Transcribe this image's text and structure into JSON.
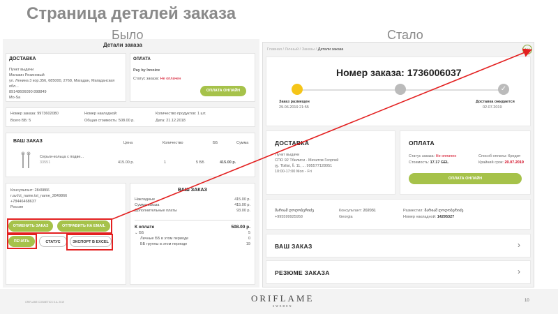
{
  "slide": {
    "title": "Страница деталей заказа",
    "before_label": "Было",
    "after_label": "Стало",
    "page_number": "10",
    "footnote": "ORIFLAME COSMETICS S.A. 2019",
    "logo": "ORIFLAME",
    "logo_sub": "SWEDEN"
  },
  "before": {
    "header": "Детали заказа",
    "delivery": {
      "title": "ДОСТАВКА",
      "lines": [
        "Пункт выдачи",
        "Магазин Резиновый",
        "ул. Ленина 3 кор.356, 685000, 2768, Магадан, Магаданская обл...",
        "89148606090 898849",
        "Mo-Sa"
      ]
    },
    "payment": {
      "title": "ОПЛАТА",
      "method": "Pay by Invoice",
      "status_label": "Статус заказа:",
      "status_value": "Не оплачен",
      "pay_button": "ОПЛАТА ОНЛАЙН"
    },
    "info": {
      "order_no": "Номер заказа: 9973602080",
      "bb_total": "Всего ББ: 5",
      "waybill": "Номер накладной:",
      "total_cost": "Общая стоимость: 508.00 р.",
      "product_count": "Количество продуктов: 1 шт.",
      "date": "Дата: 21.12.2018"
    },
    "order": {
      "title": "ВАШ ЗАКАЗ",
      "columns": [
        "Цена",
        "Количество",
        "ББ",
        "Сумма"
      ],
      "item_name": "Серьги-кольца с подве...",
      "item_code": "33551",
      "item_price": "415.00 р.",
      "item_qty": "1",
      "item_bb": "5 ББ",
      "item_sum": "415.00 р."
    },
    "consultant_lines": [
      "Консультант: 2849866",
      "r.av.fct_name.txt_name_2849866",
      "+78446468637",
      "Россия"
    ],
    "summary": {
      "title": "ВАШ ЗАКАЗ",
      "rows": [
        {
          "label": "Накладные",
          "value": "415.00 р."
        },
        {
          "label": "Сумма заказа",
          "value": "415.00 р."
        },
        {
          "label": "Дополнительные платы",
          "value": "93.00 р."
        }
      ],
      "to_pay_label": "К оплате",
      "to_pay_value": "508.00 р.",
      "bb_label": "ББ",
      "bb_value": "5",
      "sub_rows": [
        {
          "label": "Личные ББ в этом периоде",
          "value": "0"
        },
        {
          "label": "ББ группы в этом периоде",
          "value": "19"
        }
      ]
    },
    "buttons": {
      "change": "ОТМЕНИТЬ ЗАКАЗ",
      "send": "ОТПРАВИТЬ НА EMAIL",
      "print": "ПЕЧАТЬ",
      "status": "СТАТУС",
      "export": "ЭКСПОРТ В EXCEL"
    }
  },
  "after": {
    "breadcrumb": [
      "Главная",
      "Личный",
      "Заказы",
      "Детали заказа"
    ],
    "order_title": "Номер заказа: 1736006037",
    "steps": [
      {
        "label": "Заказ размещен",
        "date": "29.06.2019 21:55"
      },
      {
        "label": "",
        "date": ""
      },
      {
        "label": "Доставка ожидается",
        "date": "02.07.2019"
      }
    ],
    "delivery": {
      "title": "ДОСТАВКА",
      "lines": [
        "Пункт выдачи",
        "СПО 92 Тбилиси - Мечитов Георгий",
        "ფ. Tbilisi, ჩ. 11, ... 995577128051",
        "10:00-17:00 Mon - Fri"
      ]
    },
    "payment": {
      "title": "ОПЛАТА",
      "status_label": "Статус заказа:",
      "status_value": "Не оплачен",
      "cost_label": "Стоимость:",
      "cost_value": "17.17 GEL",
      "method_label": "Способ оплаты:",
      "method_value": "Кредит",
      "deadline_label": "Крайний срок:",
      "deadline_value": "20.07.2019",
      "pay_button": "ОПЛАТА ОНЛАЙН"
    },
    "contacts": {
      "name": "მარიამ ღოღობერიძე",
      "phone": "+995599925958",
      "consultant_label": "Консультант:",
      "consultant_value": "202031",
      "country": "Georgia",
      "placed_label": "Разместил:",
      "placed_value": "მარიამ ღოღობერიძე",
      "waybill_label": "Номер накладной:",
      "waybill_value": "14295327"
    },
    "accordion": [
      "ВАШ ЗАКАЗ",
      "РЕЗЮМЕ ЗАКАЗА"
    ],
    "more_icon": "ellipsis-icon"
  },
  "colors": {
    "accent": "#a6c24a",
    "highlight": "#e32020",
    "status": "#d0021b"
  }
}
